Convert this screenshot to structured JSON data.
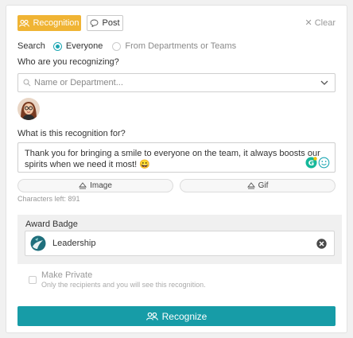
{
  "tabs": {
    "recognition": "Recognition",
    "post": "Post"
  },
  "clear_label": "Clear",
  "search": {
    "label": "Search",
    "option_everyone": "Everyone",
    "option_departments": "From Departments or Teams",
    "selected": "Everyone"
  },
  "recipient": {
    "question": "Who are you recognizing?",
    "placeholder": "Name or Department..."
  },
  "reason": {
    "question": "What is this recognition for?",
    "text": "Thank you for bringing a smile to everyone on the team, it always boosts our spirits when we need it most! 😀"
  },
  "attachments": {
    "image_label": "Image",
    "gif_label": "Gif"
  },
  "characters_left": "Characters left: 891",
  "award": {
    "title": "Award Badge",
    "badge_name": "Leadership"
  },
  "private": {
    "label": "Make Private",
    "description": "Only the recipients and you will see this recognition."
  },
  "submit_label": "Recognize",
  "colors": {
    "accent_yellow": "#f0b434",
    "primary_teal": "#179ca7"
  }
}
